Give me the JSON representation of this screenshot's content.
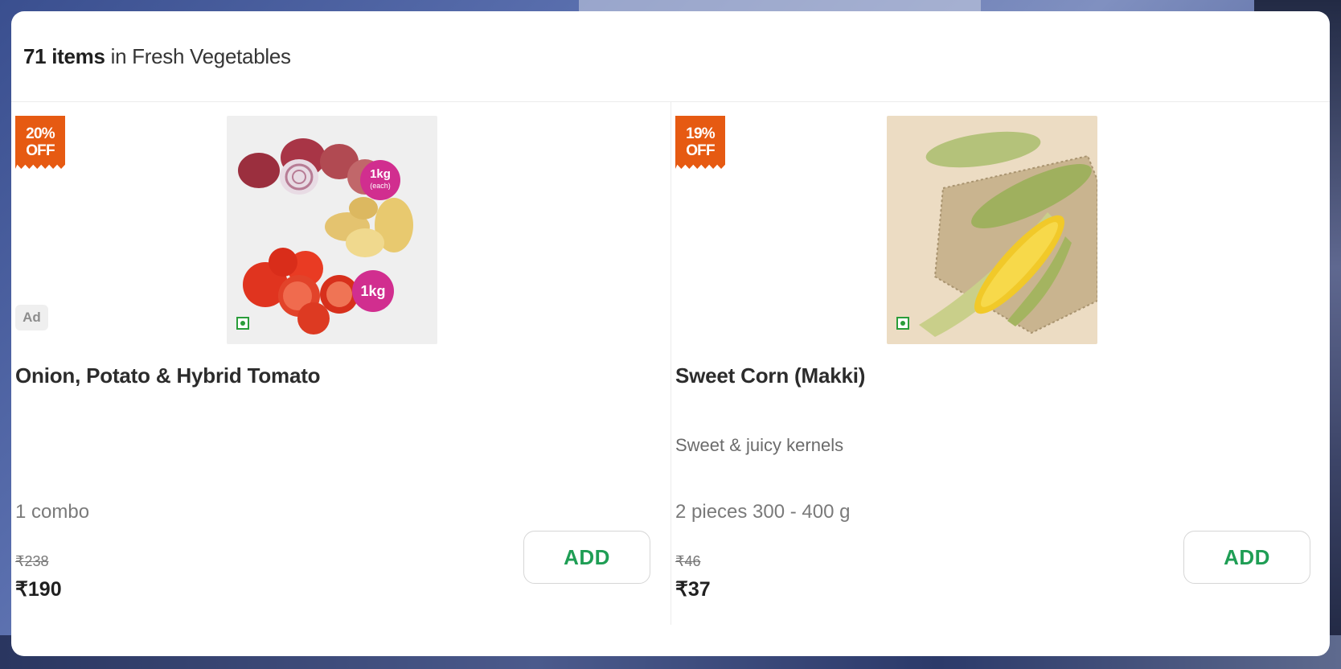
{
  "header": {
    "count": "71 items",
    "suffix": " in Fresh Vegetables"
  },
  "products": [
    {
      "discount_line1": "20%",
      "discount_line2": "OFF",
      "ad_label": "Ad",
      "name": "Onion, Potato & Hybrid Tomato",
      "description": "",
      "quantity": "1 combo",
      "mrp": "₹238",
      "price": "₹190",
      "add_label": "ADD",
      "image_tags": [
        "1kg",
        "(each)",
        "1kg"
      ]
    },
    {
      "discount_line1": "19%",
      "discount_line2": "OFF",
      "name": "Sweet Corn (Makki)",
      "description": "Sweet & juicy kernels",
      "quantity": "2 pieces 300 - 400 g",
      "mrp": "₹46",
      "price": "₹37",
      "add_label": "ADD"
    }
  ],
  "colors": {
    "discount_badge": "#e65a12",
    "add_text": "#1f9e55",
    "veg_mark": "#2a9d3a",
    "image_tag": "#d12e8f"
  }
}
